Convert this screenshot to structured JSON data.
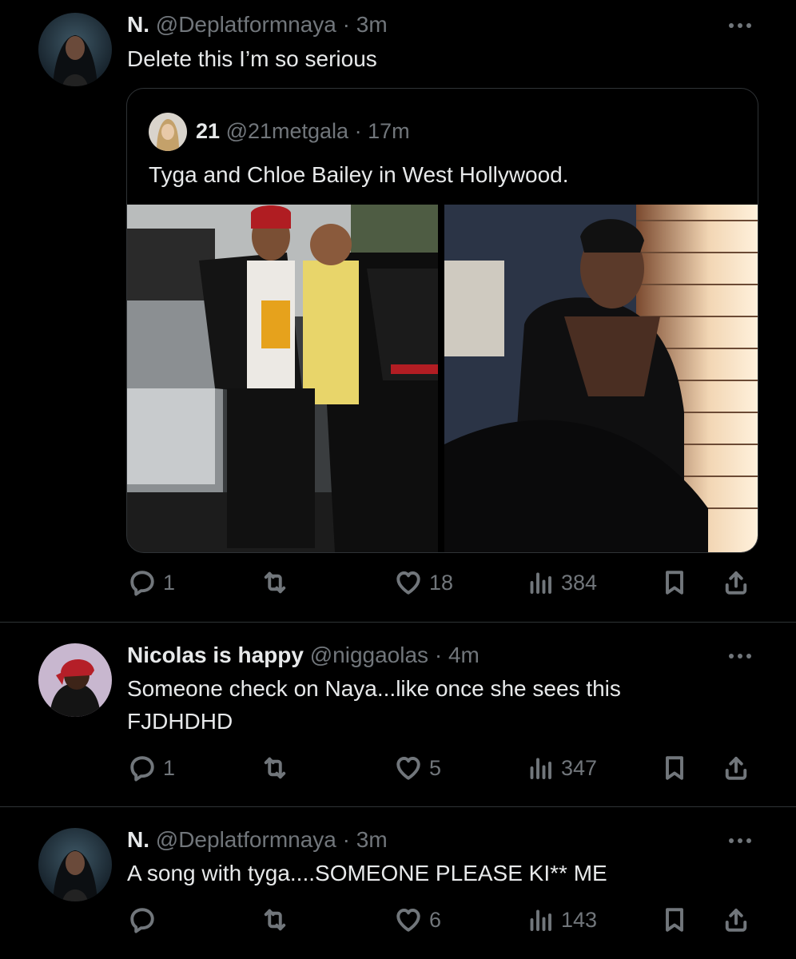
{
  "tweet1": {
    "name": "N.",
    "handle": "@Deplatformnaya",
    "time": "· 3m",
    "text": "Delete this I’m so serious",
    "quote": {
      "name": "21",
      "handle": "@21metgala",
      "time": "· 17m",
      "text": "Tyga and Chloe Bailey in West Hollywood."
    },
    "replies": "1",
    "retweets": "",
    "likes": "18",
    "views": "384"
  },
  "tweet2": {
    "name": "Nicolas is happy",
    "handle": "@niggaolas",
    "time": "· 4m",
    "text_line1": "Someone check on Naya...like once she sees this",
    "text_line2": "FJDHDHD",
    "replies": "1",
    "retweets": "",
    "likes": "5",
    "views": "347"
  },
  "tweet3": {
    "name": "N.",
    "handle": "@Deplatformnaya",
    "time": "· 3m",
    "text": "A song with tyga....SOMEONE PLEASE KI** ME",
    "replies": "",
    "retweets": "",
    "likes": "6",
    "views": "143"
  },
  "icons": {
    "reply": "reply-icon",
    "retweet": "retweet-icon",
    "like": "heart-icon",
    "views": "views-icon",
    "bookmark": "bookmark-icon",
    "share": "share-icon",
    "more": "more-icon"
  },
  "colors": {
    "background": "#000000",
    "text": "#e7e9ea",
    "secondary": "#71767b",
    "divider": "#2f3336"
  }
}
